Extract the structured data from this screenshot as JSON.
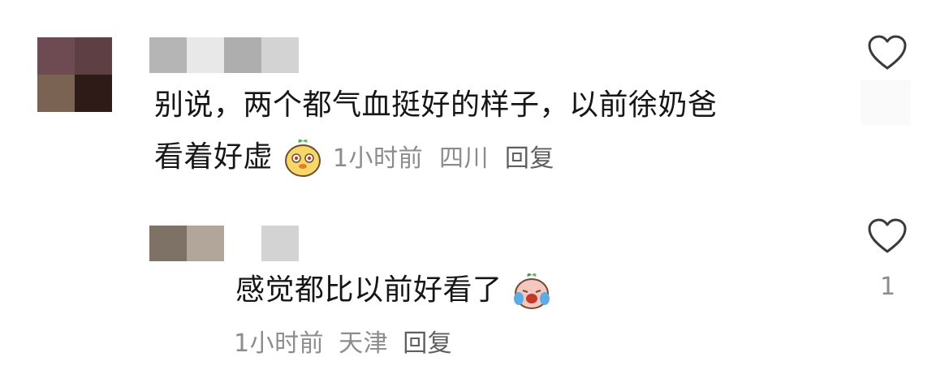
{
  "comments": [
    {
      "text_line1": "别说，两个都气血挺好的样子，以前徐奶爸",
      "text_line2": "看着好虚",
      "emoji": "smug-dog-emoji",
      "time": "1小时前",
      "location": "四川",
      "reply_label": "回复",
      "like_icon": "heart-outline-icon",
      "like_count": ""
    },
    {
      "text": "感觉都比以前好看了",
      "emoji": "crying-laughing-emoji",
      "time": "1小时前",
      "location": "天津",
      "reply_label": "回复",
      "like_icon": "heart-outline-icon",
      "like_count": "1"
    }
  ],
  "colors": {
    "text": "#161616",
    "meta": "#8c8c8c",
    "reply": "#5f5f5f",
    "icon": "#3a3a3a"
  }
}
